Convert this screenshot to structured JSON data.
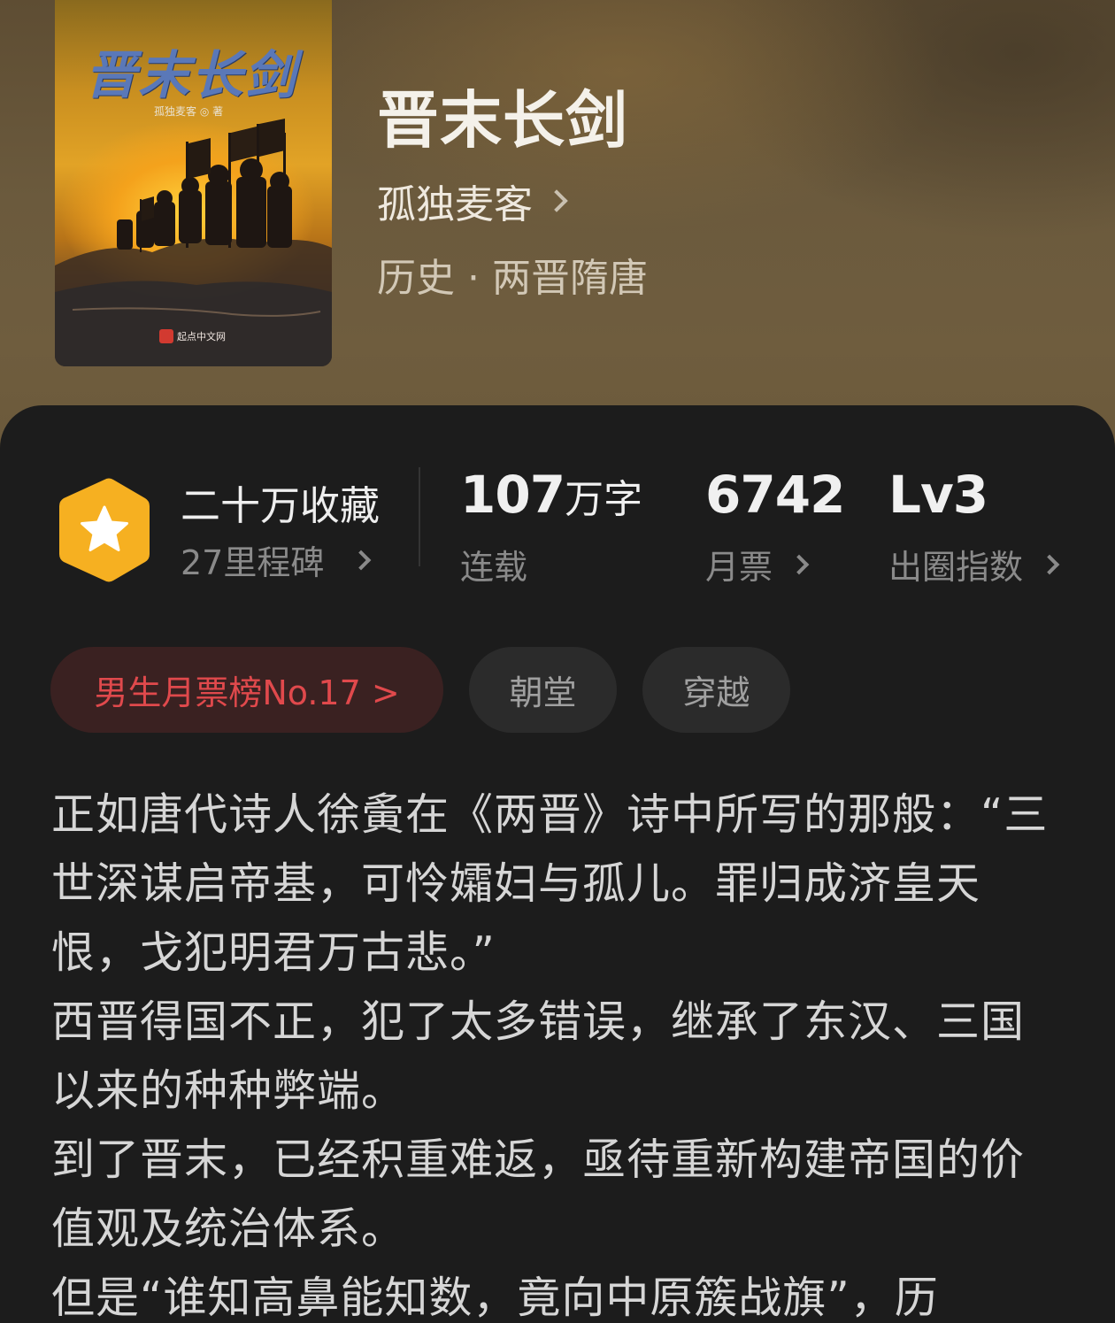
{
  "book": {
    "title": "晋末长剑",
    "author": "孤独麦客",
    "genre": "历史 · 两晋隋唐",
    "cover": {
      "title": "晋末长剑",
      "author_line": "孤独麦客 ◎ 著",
      "publisher": "起点中文网"
    }
  },
  "stats": {
    "collection": {
      "main": "二十万收藏",
      "sub": "27里程碑"
    },
    "word_count": {
      "value": "107",
      "unit": "万字",
      "label": "连载"
    },
    "monthly_votes": {
      "value": "6742",
      "label": "月票"
    },
    "level": {
      "value": "Lv3",
      "label": "出圈指数"
    }
  },
  "tags": {
    "rank": "男生月票榜No.17 >",
    "tag1": "朝堂",
    "tag2": "穿越"
  },
  "description": {
    "para1": "正如唐代诗人徐夤在《两晋》诗中所写的那般：“三世深谋启帝基，可怜孀妇与孤儿。罪归成济皇天恨，戈犯明君万古悲。”",
    "para2": "西晋得国不正，犯了太多错误，继承了东汉、三国以来的种种弊端。",
    "para3": "到了晋末，已经积重难返，亟待重新构建帝国的价值观及统治体系。",
    "para4": "但是“谁知高鼻能知数，竟向中原簇战旗”，历"
  },
  "colors": {
    "accent_rank": "#e0494c",
    "badge": "#f6b021",
    "panel_bg": "#1c1c1c"
  },
  "icons": {
    "badge": "star-hexagon-icon",
    "chevron": "chevron-right-icon"
  }
}
